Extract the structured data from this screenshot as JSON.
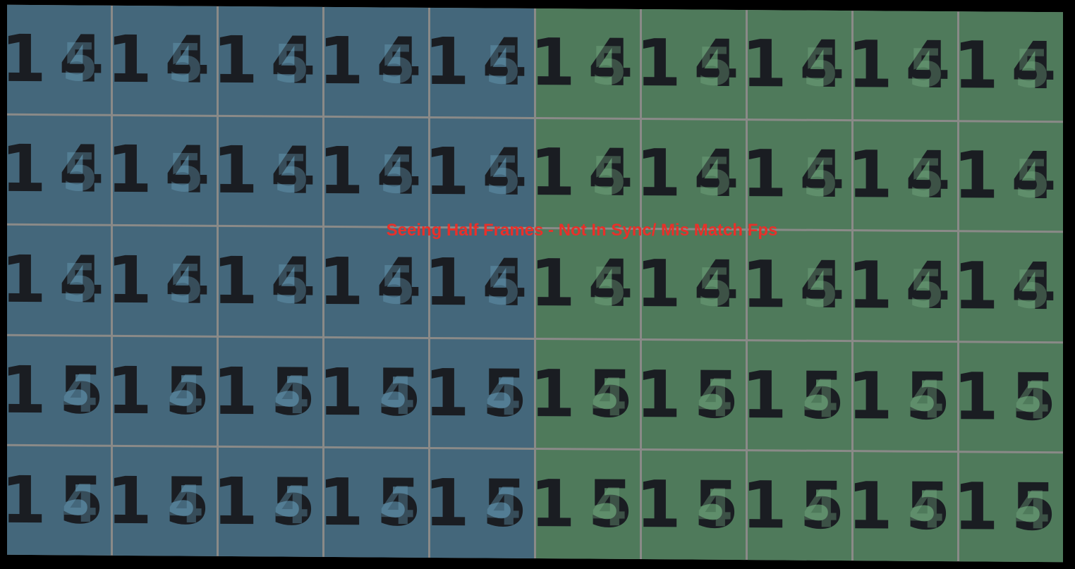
{
  "caption": "Seeing Half Frames - Not In Sync/ Mis Match Fps",
  "colors": {
    "left_half": "#44677b",
    "right_half": "#4f7a5b",
    "caption": "#e8302a"
  },
  "columns": 10,
  "rows": [
    {
      "number": "14",
      "ghost": "5"
    },
    {
      "number": "14",
      "ghost": "5"
    },
    {
      "number": "14",
      "ghost": "5"
    },
    {
      "number": "15",
      "ghost": "4"
    },
    {
      "number": "15",
      "ghost": "4"
    }
  ]
}
